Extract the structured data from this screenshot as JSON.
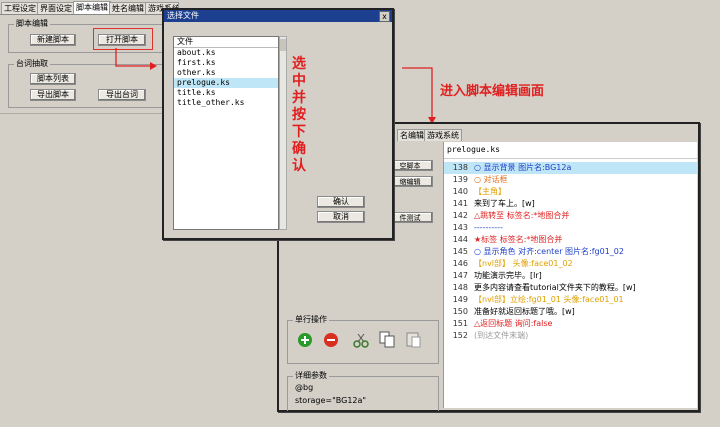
{
  "tabs": [
    "工程设定",
    "界面设定",
    "脚本编辑",
    "姓名编辑",
    "游戏系统"
  ],
  "back_window": {
    "group_script_edit": "脚本编辑",
    "btn_new_script": "新建脚本",
    "btn_open_script": "打开脚本",
    "group_dialog_extract": "台词抽取",
    "btn_script_list": "脚本列表",
    "btn_export_script": "导出脚本",
    "btn_export_dialog": "导出台词"
  },
  "file_dialog": {
    "title": "选择文件",
    "close": "x",
    "list_header": "文件",
    "files": [
      "about.ks",
      "first.ks",
      "other.ks",
      "prelogue.ks",
      "title.ks",
      "title_other.ks"
    ],
    "selected_index": 3,
    "btn_ok": "确认",
    "btn_cancel": "取消"
  },
  "annotations": {
    "vertical_note": [
      "选",
      "中",
      "并",
      "按",
      "下",
      "确",
      "认"
    ],
    "arrow_note": "进入脚本编辑画面"
  },
  "editor": {
    "tabs": [
      "名编辑",
      "游戏系统"
    ],
    "file_name": "prelogue.ks",
    "side_buttons": [
      "空脚本",
      "缩编辑",
      "件测试"
    ],
    "single_op_label": "单行操作",
    "detail_label": "详细参数",
    "detail_lines": [
      "@bg",
      "storage=\"BG12a\""
    ],
    "lines": [
      {
        "n": "138",
        "t": "○ 显示背景 图片名:BG12a",
        "c": "#1e3fc8",
        "hl": true
      },
      {
        "n": "139",
        "t": "○ 对话框",
        "c": "#e07020"
      },
      {
        "n": "140",
        "t": "【主角】",
        "c": "#e0a000"
      },
      {
        "n": "141",
        "t": "来到了车上。[w]",
        "c": "#000000"
      },
      {
        "n": "142",
        "t": "△跳转至 标签名:*地图合并",
        "c": "#e02020"
      },
      {
        "n": "143",
        "t": "----------",
        "c": "#1e3fc8"
      },
      {
        "n": "144",
        "t": "★标签 标签名:*地图合并",
        "c": "#e02020"
      },
      {
        "n": "145",
        "t": "○ 显示角色 对齐:center 图片名:fg01_02",
        "c": "#1e3fc8"
      },
      {
        "n": "146",
        "t": "【nvl部】 头像:face01_02",
        "c": "#e0a000"
      },
      {
        "n": "147",
        "t": "功能演示完毕。[lr]",
        "c": "#000000"
      },
      {
        "n": "148",
        "t": "更多内容请查看tutorial文件夹下的教程。[w]",
        "c": "#000000"
      },
      {
        "n": "149",
        "t": "【nvl部】立绘:fg01_01 头像:face01_01",
        "c": "#e0a000"
      },
      {
        "n": "150",
        "t": "准备好就返回标题了哦。[w]",
        "c": "#000000"
      },
      {
        "n": "151",
        "t": "△返回标题 询问:false",
        "c": "#e02020"
      },
      {
        "n": "152",
        "t": "(到达文件末端)",
        "c": "#999999"
      }
    ]
  },
  "colors": {
    "title_bar": "#1c3f8f",
    "annotation_red": "#e02020",
    "selection": "#bfe6f6"
  }
}
